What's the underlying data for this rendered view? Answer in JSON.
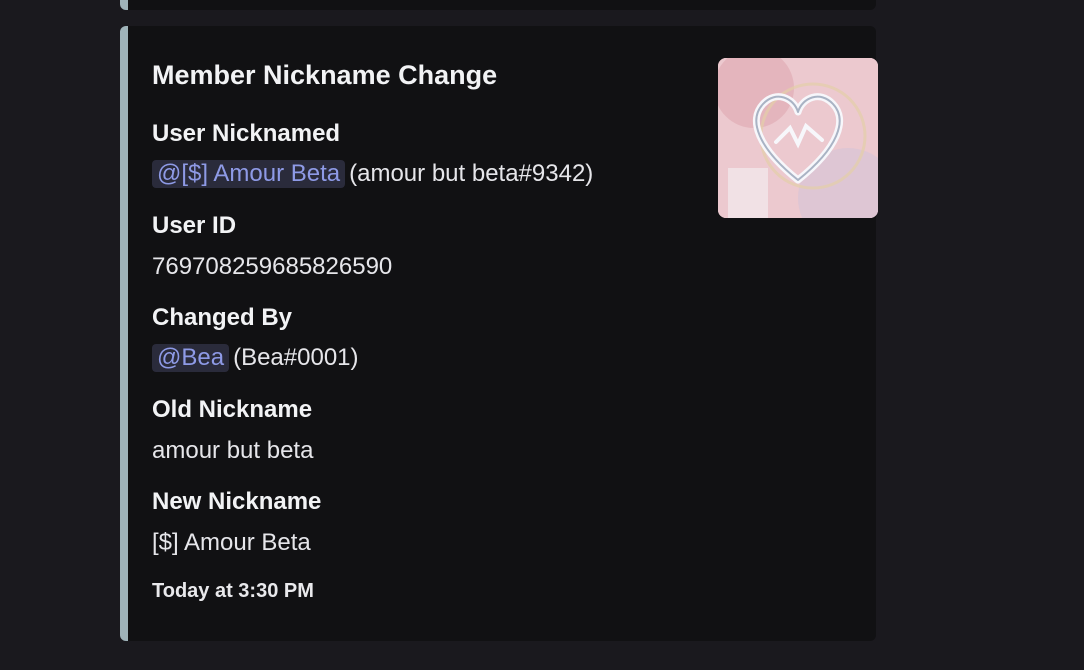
{
  "embed": {
    "title": "Member Nickname Change",
    "accent_color": "#9fb3b9",
    "fields": [
      {
        "name": "User Nicknamed",
        "mention": "@[$] Amour Beta",
        "value": "(amour but beta#9342)"
      },
      {
        "name": "User ID",
        "value": "769708259685826590"
      },
      {
        "name": "Changed By",
        "mention": "@Bea",
        "value": "(Bea#0001)"
      },
      {
        "name": "Old Nickname",
        "value": "amour but beta"
      },
      {
        "name": "New Nickname",
        "value": "[$] Amour Beta"
      }
    ],
    "timestamp": "Today at 3:30 PM",
    "thumbnail": {
      "icon": "heart-logo-icon"
    }
  },
  "colors": {
    "background": "#1a191e",
    "embed_bg": "#111113",
    "mention_text": "#8e9ae6",
    "mention_bg": "#2a2b3b"
  }
}
